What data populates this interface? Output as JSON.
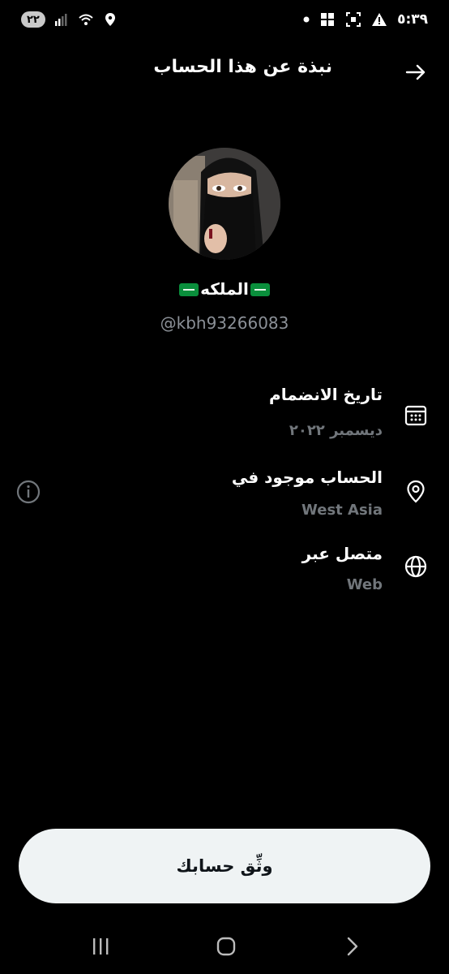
{
  "status_bar": {
    "time": "٥:٣٩",
    "battery": "٢٢"
  },
  "header": {
    "title": "نبذة عن هذا الحساب"
  },
  "profile": {
    "name": "الملكه",
    "handle": "@kbh93266083"
  },
  "info": {
    "joined_label": "تاريخ الانضمام",
    "joined_value": "ديسمبر ٢٠٢٢",
    "location_label": "الحساب موجود في",
    "location_value": "West Asia",
    "connected_label": "متصل عبر",
    "connected_value": "Web"
  },
  "verify_button": {
    "label": "وثِّق حسابك"
  },
  "icons": {
    "back": "arrow-right-icon",
    "joined": "calendar-icon",
    "location": "location-pin-icon",
    "connected": "globe-icon",
    "info": "info-icon"
  },
  "colors": {
    "background": "#000000",
    "secondary_text": "#71767b",
    "button_bg": "#eff3f4"
  }
}
